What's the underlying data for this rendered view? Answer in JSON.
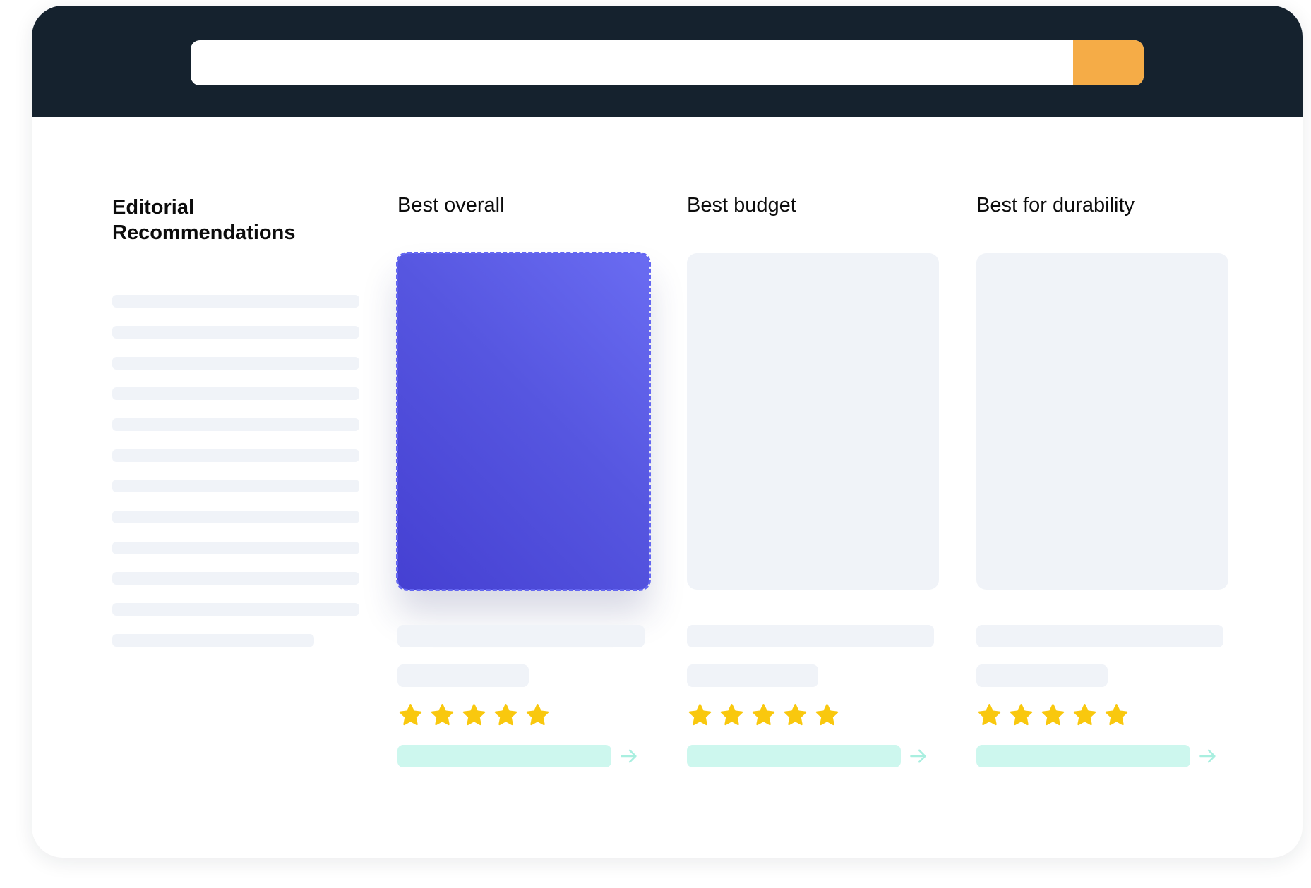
{
  "header": {
    "search": {
      "value": "",
      "placeholder": "",
      "button_icon": "search-icon"
    },
    "colors": {
      "bar": "#15222e",
      "button": "#f5ac47"
    }
  },
  "section": {
    "heading": "Editorial\nRecommendations",
    "columns": [
      {
        "title": "Best overall",
        "selected": true,
        "rating": 5
      },
      {
        "title": "Best budget",
        "selected": false,
        "rating": 5
      },
      {
        "title": "Best for durability",
        "selected": false,
        "rating": 5
      }
    ]
  },
  "colors": {
    "selected_card": "#5656e0",
    "placeholder": "#f0f3f8",
    "star": "#f9c80e",
    "cta": "#cdf7ee",
    "arrow": "#a9efe0"
  }
}
